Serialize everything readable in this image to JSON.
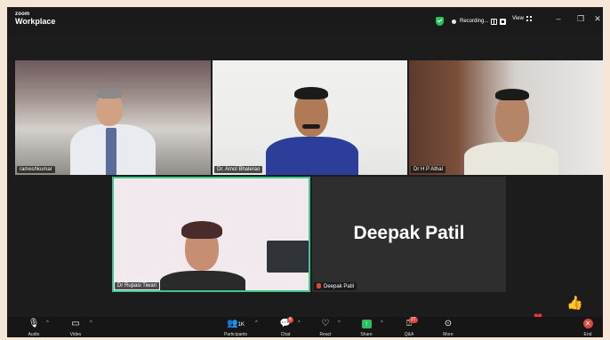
{
  "app": {
    "brand_top": "zoom",
    "brand_bottom": "Workplace"
  },
  "titlebar": {
    "recording_label": "Recording...",
    "view_label": "View",
    "window_controls": [
      "–",
      "❐",
      "✕"
    ]
  },
  "tiles": [
    {
      "name": "rameshkumar"
    },
    {
      "name": "Dr. Amol Bhalerao"
    },
    {
      "name": "Dr H P Athal"
    },
    {
      "name": "Dr Rupasi Tiwari"
    },
    {
      "name": "Deepak Patil",
      "display_name": "Deepak Patil",
      "muted": true
    }
  ],
  "toolbar": {
    "audio": {
      "label": "Audio",
      "icon": "mic-icon"
    },
    "video": {
      "label": "Video",
      "icon": "camera-icon"
    },
    "participants": {
      "label": "Participants",
      "count": "1K",
      "icon": "participants-icon"
    },
    "chat": {
      "label": "Chat",
      "badge": "8",
      "icon": "chat-icon"
    },
    "react": {
      "label": "React",
      "icon": "heart-icon"
    },
    "share": {
      "label": "Share",
      "icon": "share-icon"
    },
    "qa": {
      "label": "Q&A",
      "badge": "27",
      "icon": "qa-icon"
    },
    "more": {
      "label": "More",
      "icon": "more-icon"
    },
    "end": {
      "label": "End",
      "icon": "end-icon"
    }
  },
  "colors": {
    "accent": "#3fc78e",
    "end": "#e0463c",
    "share": "#28c062"
  }
}
